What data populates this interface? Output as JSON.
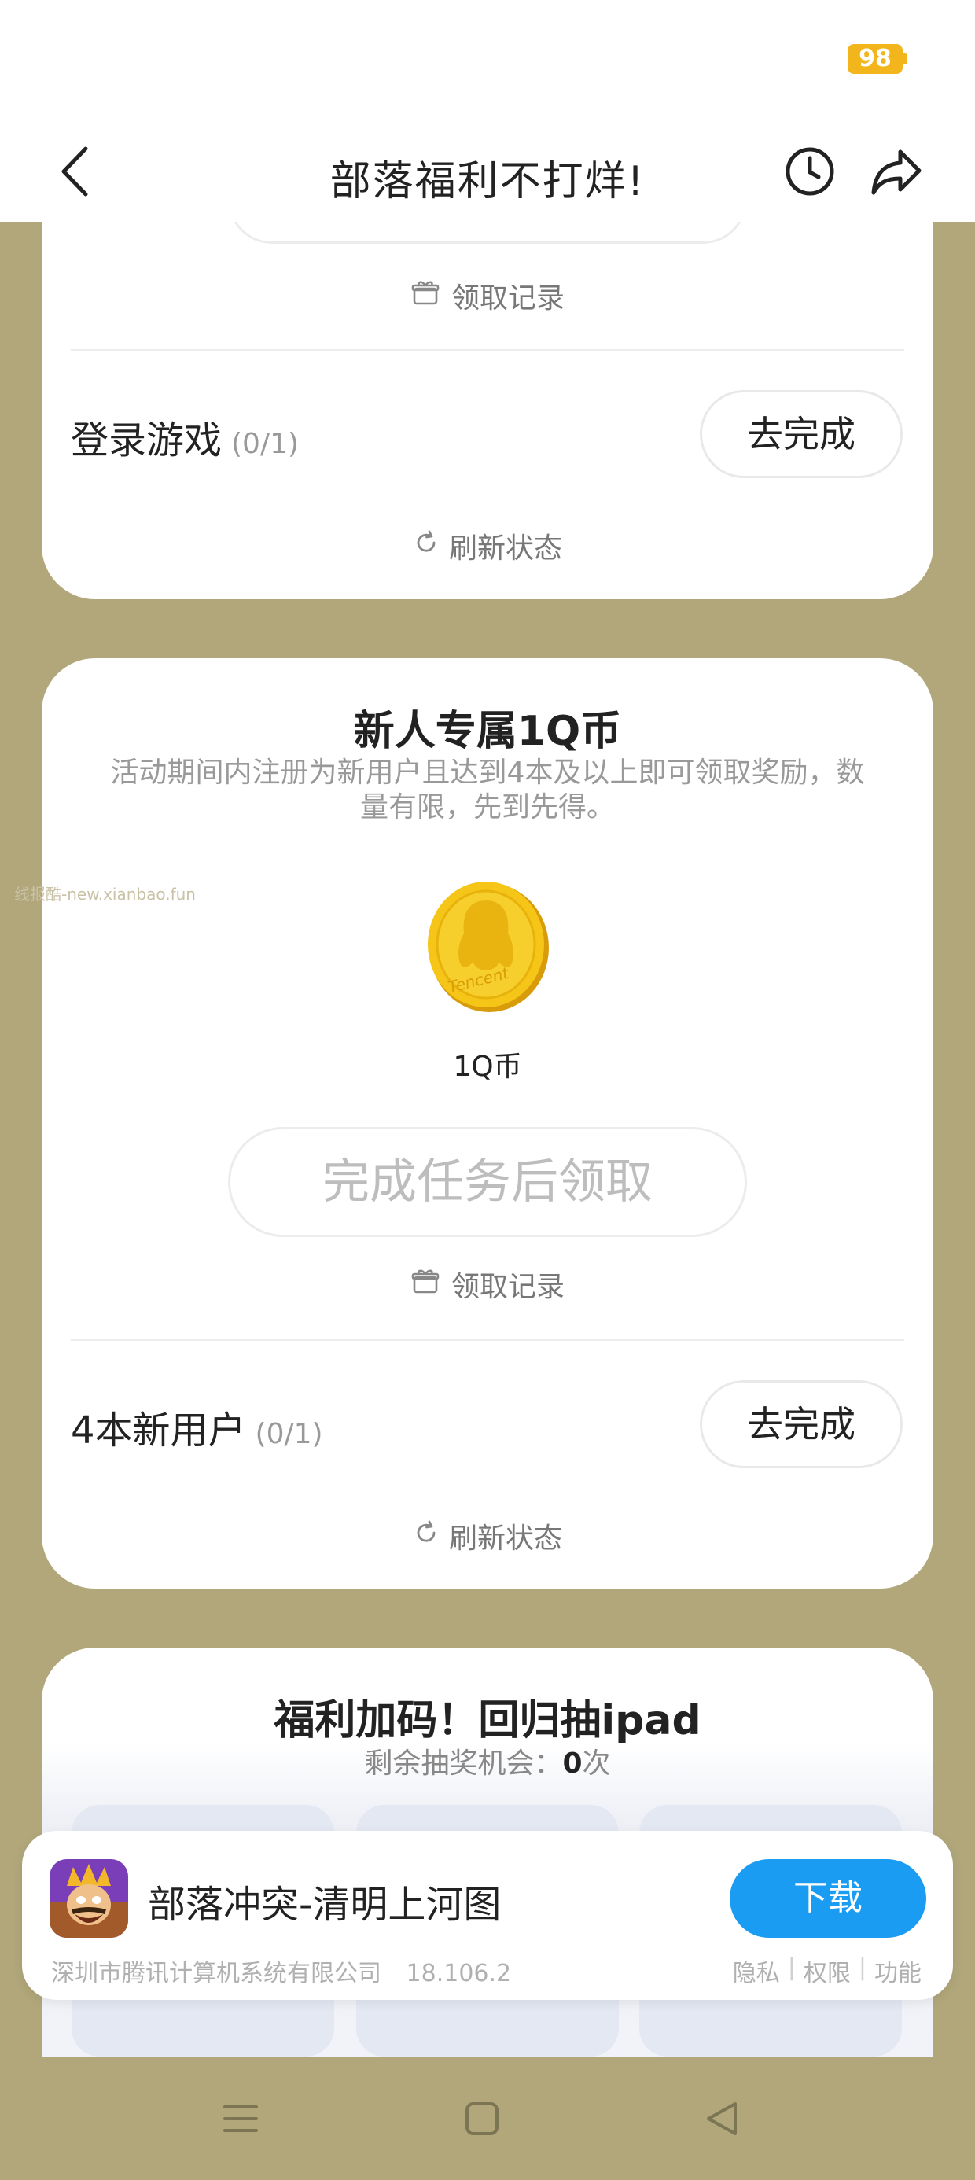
{
  "status_bar": {
    "battery": "98"
  },
  "nav": {
    "title": "部落福利不打烊!"
  },
  "card1": {
    "record_label": "领取记录",
    "task_name": "登录游戏",
    "task_progress": "(0/1)",
    "go_label": "去完成",
    "refresh_label": "刷新状态"
  },
  "card2": {
    "title": "新人专属1Q币",
    "description": "活动期间内注册为新用户且达到4本及以上即可领取奖励，数量有限，先到先得。",
    "coin_label": "1Q币",
    "coin_brand": "Tencent",
    "claim_label": "完成任务后领取",
    "record_label": "领取记录",
    "task_name": "4本新用户",
    "task_progress": "(0/1)",
    "go_label": "去完成",
    "refresh_label": "刷新状态"
  },
  "watermark": "线报酷-new.xianbao.fun",
  "card3": {
    "title": "福利加码！回归抽ipad",
    "chances_prefix": "剩余抽奖机会：",
    "chances_value": "0",
    "chances_suffix": "次"
  },
  "app_banner": {
    "name": "部落冲突-清明上河图",
    "download_label": "下载",
    "company": "深圳市腾讯计算机系统有限公司",
    "version": "18.106.2",
    "links": [
      "隐私",
      "权限",
      "功能"
    ]
  },
  "colors": {
    "page_background": "#b1a77b",
    "accent_blue": "#1a9cf2",
    "battery_yellow": "#f2b51c",
    "coin_gold": "#f5c518"
  },
  "icons": {
    "back": "back-arrow-icon",
    "history": "clock-icon",
    "share": "share-icon",
    "gift": "gift-icon",
    "refresh": "refresh-icon",
    "menu": "menu-icon",
    "home": "home-icon",
    "back_nav": "triangle-back-icon"
  }
}
